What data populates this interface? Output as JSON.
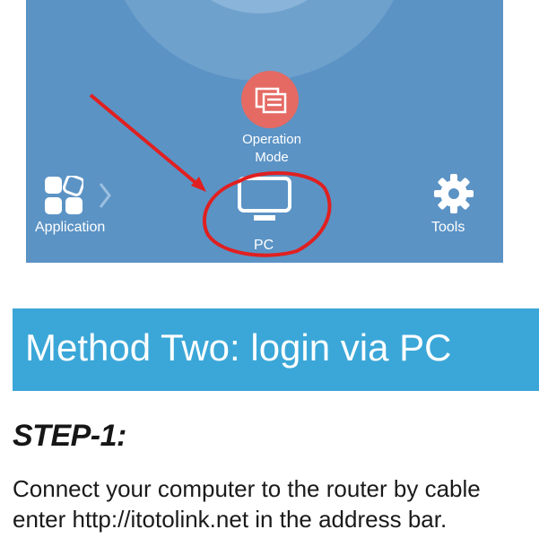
{
  "app_screenshot": {
    "nav_items": [
      {
        "label": "Operation\nMode",
        "icon": "operation-mode-icon"
      },
      {
        "label": "Application",
        "icon": "application-grid-icon"
      },
      {
        "label": "PC",
        "icon": "monitor-icon"
      },
      {
        "label": "Tools",
        "icon": "gear-icon"
      }
    ],
    "colors": {
      "background": "#5b93c5",
      "dial": "#6fa1cd",
      "operation_mode_badge": "#e46a63",
      "annotation": "#e02020"
    }
  },
  "banner": {
    "title": "Method Two: login via PC",
    "color": "#3ba7d8"
  },
  "step": {
    "heading": "STEP-1:",
    "line1": "Connect your computer to the router by cable",
    "line2": "enter http://itotolink.net in the address bar."
  }
}
